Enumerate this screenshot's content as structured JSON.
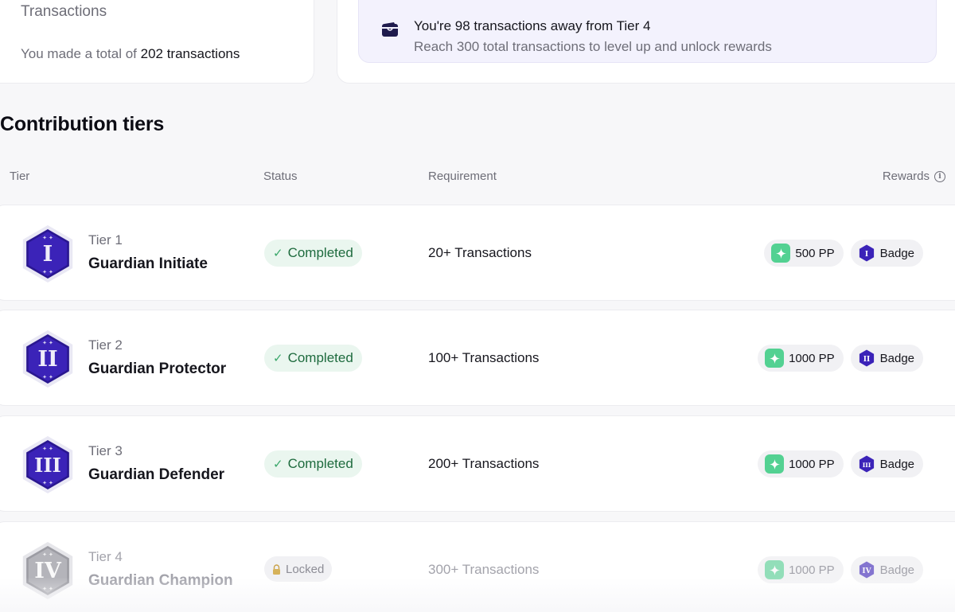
{
  "summary": {
    "label": "Transactions",
    "total_prefix": "You made a total of",
    "total_value": "202 transactions"
  },
  "notice": {
    "icon": "wallet-icon",
    "title": "You're 98 transactions away from Tier 4",
    "subtitle": "Reach 300 total transactions to level up and unlock rewards"
  },
  "section_title": "Contribution tiers",
  "columns": {
    "tier": "Tier",
    "status": "Status",
    "requirement": "Requirement",
    "rewards": "Rewards"
  },
  "tiers": [
    {
      "tier_label": "Tier 1",
      "name": "Guardian Initiate",
      "numeral": "I",
      "status": "Completed",
      "requirement": "20+ Transactions",
      "points": "500 PP",
      "badge": "Badge",
      "locked": false
    },
    {
      "tier_label": "Tier 2",
      "name": "Guardian Protector",
      "numeral": "II",
      "status": "Completed",
      "requirement": "100+ Transactions",
      "points": "1000 PP",
      "badge": "Badge",
      "locked": false
    },
    {
      "tier_label": "Tier 3",
      "name": "Guardian Defender",
      "numeral": "III",
      "status": "Completed",
      "requirement": "200+ Transactions",
      "points": "1000 PP",
      "badge": "Badge",
      "locked": false
    },
    {
      "tier_label": "Tier 4",
      "name": "Guardian Champion",
      "numeral": "IV",
      "status": "Locked",
      "requirement": "300+ Transactions",
      "points": "1000 PP",
      "badge": "Badge",
      "locked": true
    }
  ],
  "colors": {
    "brand_purple": "#3b23b8",
    "completed_green": "#3aa76a",
    "points_green": "#53d192",
    "locked_gray": "#a3a3ab"
  }
}
